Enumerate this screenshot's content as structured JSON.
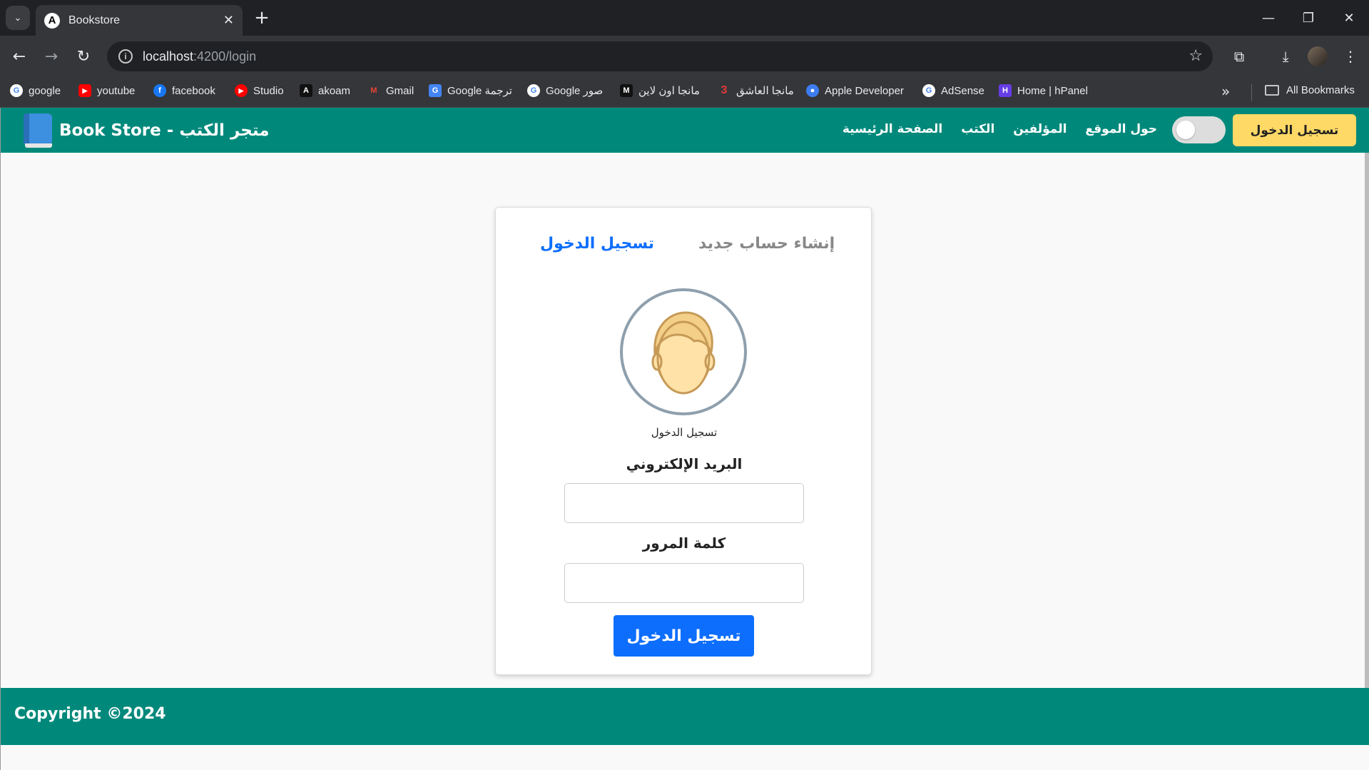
{
  "browser": {
    "tab_title": "Bookstore",
    "tab_favicon_letter": "A",
    "url_host": "localhost",
    "url_path": ":4200/login"
  },
  "bookmarks": [
    {
      "label": "google",
      "icon": "google-icon",
      "color": "#4285f4",
      "letter": "G"
    },
    {
      "label": "youtube",
      "icon": "youtube-icon",
      "color": "#ff0000",
      "letter": "▶"
    },
    {
      "label": "facebook",
      "icon": "facebook-icon",
      "color": "#1877f2",
      "letter": "f"
    },
    {
      "label": "Studio",
      "icon": "youtube-studio-icon",
      "color": "#ff0000",
      "letter": "▶"
    },
    {
      "label": "akoam",
      "icon": "akoam-icon",
      "color": "#111111",
      "letter": "A"
    },
    {
      "label": "Gmail",
      "icon": "gmail-icon",
      "color": "#ea4335",
      "letter": "M"
    },
    {
      "label": "Google ترجمة",
      "icon": "google-translate-icon",
      "color": "#4285f4",
      "letter": "G"
    },
    {
      "label": "Google صور",
      "icon": "google-icon",
      "color": "#4285f4",
      "letter": "G"
    },
    {
      "label": "مانجا اون لاين",
      "icon": "manga-online-icon",
      "color": "#111111",
      "letter": "M"
    },
    {
      "label": "مانجا العاشق",
      "icon": "manga-lover-icon",
      "color": "#e53935",
      "letter": "3"
    },
    {
      "label": "Apple Developer",
      "icon": "apple-developer-icon",
      "color": "#3d7cf0",
      "letter": "●"
    },
    {
      "label": "AdSense",
      "icon": "google-icon",
      "color": "#4285f4",
      "letter": "G"
    },
    {
      "label": "Home | hPanel",
      "icon": "hostinger-icon",
      "color": "#673de6",
      "letter": "H"
    }
  ],
  "all_bookmarks": "All Bookmarks",
  "navbar": {
    "brand": "Book Store - متجر الكتب",
    "links": [
      "الصفحة الرئيسية",
      "الكتب",
      "المؤلفين",
      "حول الموقع"
    ],
    "login_button": "تسجيل الدخول"
  },
  "card": {
    "tab_login": "تسجيل الدخول",
    "tab_register": "إنشاء حساب جديد",
    "avatar_label": "تسجيل الدخول",
    "email_label": "البريد الإلكتروني",
    "email_value": "",
    "password_label": "كلمة المرور",
    "password_value": "",
    "submit": "تسجيل الدخول"
  },
  "footer": {
    "copyright": "Copyright ©2024"
  },
  "colors": {
    "primary": "#00897b",
    "accent_blue": "#0d6efd",
    "nav_button": "#ffd966"
  }
}
